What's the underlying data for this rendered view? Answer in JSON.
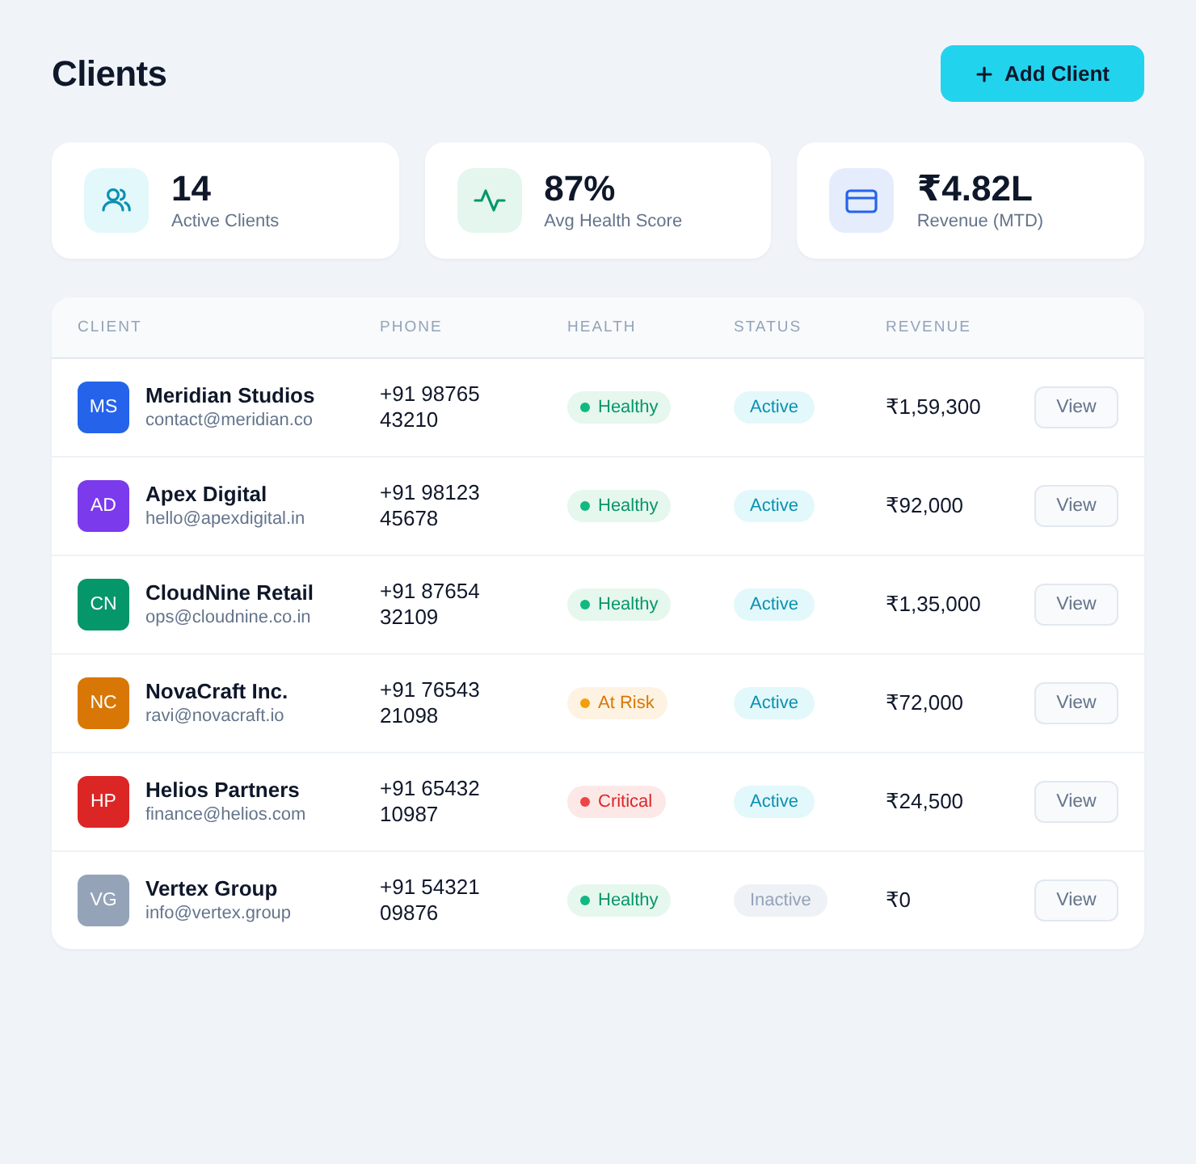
{
  "header": {
    "title": "Clients",
    "add_button": "Add Client"
  },
  "stats": [
    {
      "kind": "clients",
      "value": "14",
      "label": "Active Clients"
    },
    {
      "kind": "health",
      "value": "87%",
      "label": "Avg Health Score"
    },
    {
      "kind": "revenue",
      "value": "₹4.82L",
      "label": "Revenue (MTD)"
    }
  ],
  "table": {
    "columns": [
      "CLIENT",
      "PHONE",
      "HEALTH",
      "STATUS",
      "REVENUE"
    ],
    "rows": [
      {
        "avatar": {
          "initials": "MS",
          "color": "#2563eb"
        },
        "name": "Meridian Studios",
        "email": "contact@meridian.co",
        "phone": "+91 98765 43210",
        "health": {
          "kind": "healthy",
          "label": "Healthy"
        },
        "status": {
          "active": true,
          "label": "Active"
        },
        "revenue": "₹1,59,300",
        "action": "View"
      },
      {
        "avatar": {
          "initials": "AD",
          "color": "#7c3aed"
        },
        "name": "Apex Digital",
        "email": "hello@apexdigital.in",
        "phone": "+91 98123 45678",
        "health": {
          "kind": "healthy",
          "label": "Healthy"
        },
        "status": {
          "active": true,
          "label": "Active"
        },
        "revenue": "₹92,000",
        "action": "View"
      },
      {
        "avatar": {
          "initials": "CN",
          "color": "#059669"
        },
        "name": "CloudNine Retail",
        "email": "ops@cloudnine.co.in",
        "phone": "+91 87654 32109",
        "health": {
          "kind": "healthy",
          "label": "Healthy"
        },
        "status": {
          "active": true,
          "label": "Active"
        },
        "revenue": "₹1,35,000",
        "action": "View"
      },
      {
        "avatar": {
          "initials": "NC",
          "color": "#d97706"
        },
        "name": "NovaCraft Inc.",
        "email": "ravi@novacraft.io",
        "phone": "+91 76543 21098",
        "health": {
          "kind": "at_risk",
          "label": "At Risk"
        },
        "status": {
          "active": true,
          "label": "Active"
        },
        "revenue": "₹72,000",
        "action": "View"
      },
      {
        "avatar": {
          "initials": "HP",
          "color": "#dc2626"
        },
        "name": "Helios Partners",
        "email": "finance@helios.com",
        "phone": "+91 65432 10987",
        "health": {
          "kind": "critical",
          "label": "Critical"
        },
        "status": {
          "active": true,
          "label": "Active"
        },
        "revenue": "₹24,500",
        "action": "View"
      },
      {
        "avatar": {
          "initials": "VG",
          "color": "#94a3b8"
        },
        "name": "Vertex Group",
        "email": "info@vertex.group",
        "phone": "+91 54321 09876",
        "health": {
          "kind": "healthy",
          "label": "Healthy"
        },
        "status": {
          "active": false,
          "label": "Inactive"
        },
        "revenue": "₹0",
        "action": "View"
      }
    ]
  }
}
